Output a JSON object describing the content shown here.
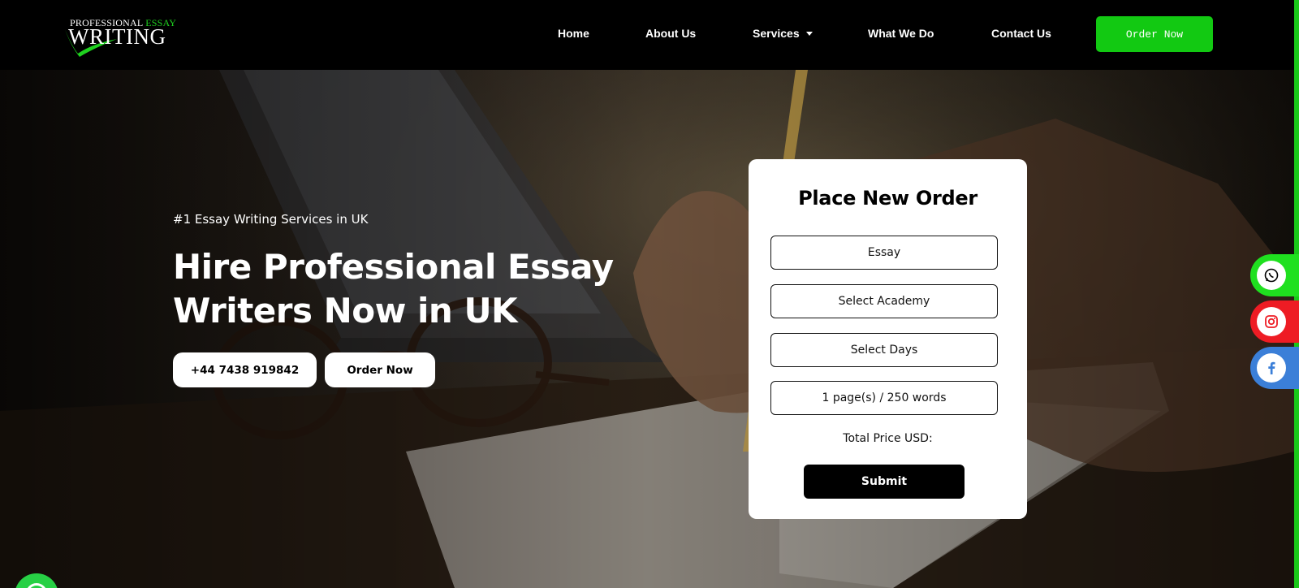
{
  "header": {
    "logo": {
      "line1_a": "PROFESSIONAL",
      "line1_b": "ESSAY",
      "line2": "WRITING"
    },
    "nav": [
      {
        "label": "Home"
      },
      {
        "label": "About Us"
      },
      {
        "label": "Services"
      },
      {
        "label": "What We Do"
      },
      {
        "label": "Contact Us"
      }
    ],
    "order_button": "Order Now"
  },
  "hero": {
    "tagline": "#1 Essay Writing Services in UK",
    "headline_line1": "Hire Professional Essay",
    "headline_line2": "Writers Now in UK",
    "phone_button": "+44 7438 919842",
    "order_button": "Order Now"
  },
  "order_form": {
    "title": "Place New Order",
    "paper_type": "Essay",
    "academy": "Select Academy",
    "days": "Select Days",
    "pages": "1 page(s) / 250 words",
    "total_price_label": "Total Price USD:",
    "submit": "Submit"
  },
  "social": [
    {
      "icon": "whatsapp-icon",
      "color": "#1fe01f"
    },
    {
      "icon": "instagram-icon",
      "color": "#ee1c24"
    },
    {
      "icon": "facebook-icon",
      "color": "#3b7fd8"
    }
  ],
  "colors": {
    "accent_green": "#12c912",
    "header_bg": "#000000",
    "card_bg": "#ffffff"
  }
}
